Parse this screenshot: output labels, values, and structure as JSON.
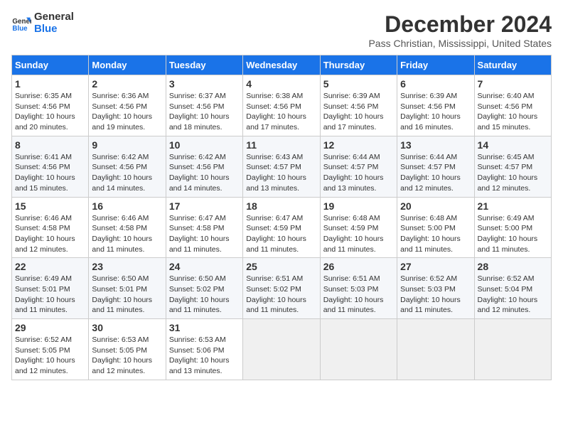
{
  "logo": {
    "line1": "General",
    "line2": "Blue"
  },
  "title": "December 2024",
  "location": "Pass Christian, Mississippi, United States",
  "days_of_week": [
    "Sunday",
    "Monday",
    "Tuesday",
    "Wednesday",
    "Thursday",
    "Friday",
    "Saturday"
  ],
  "weeks": [
    [
      {
        "day": "1",
        "sunrise": "6:35 AM",
        "sunset": "4:56 PM",
        "daylight": "10 hours and 20 minutes."
      },
      {
        "day": "2",
        "sunrise": "6:36 AM",
        "sunset": "4:56 PM",
        "daylight": "10 hours and 19 minutes."
      },
      {
        "day": "3",
        "sunrise": "6:37 AM",
        "sunset": "4:56 PM",
        "daylight": "10 hours and 18 minutes."
      },
      {
        "day": "4",
        "sunrise": "6:38 AM",
        "sunset": "4:56 PM",
        "daylight": "10 hours and 17 minutes."
      },
      {
        "day": "5",
        "sunrise": "6:39 AM",
        "sunset": "4:56 PM",
        "daylight": "10 hours and 17 minutes."
      },
      {
        "day": "6",
        "sunrise": "6:39 AM",
        "sunset": "4:56 PM",
        "daylight": "10 hours and 16 minutes."
      },
      {
        "day": "7",
        "sunrise": "6:40 AM",
        "sunset": "4:56 PM",
        "daylight": "10 hours and 15 minutes."
      }
    ],
    [
      {
        "day": "8",
        "sunrise": "6:41 AM",
        "sunset": "4:56 PM",
        "daylight": "10 hours and 15 minutes."
      },
      {
        "day": "9",
        "sunrise": "6:42 AM",
        "sunset": "4:56 PM",
        "daylight": "10 hours and 14 minutes."
      },
      {
        "day": "10",
        "sunrise": "6:42 AM",
        "sunset": "4:56 PM",
        "daylight": "10 hours and 14 minutes."
      },
      {
        "day": "11",
        "sunrise": "6:43 AM",
        "sunset": "4:57 PM",
        "daylight": "10 hours and 13 minutes."
      },
      {
        "day": "12",
        "sunrise": "6:44 AM",
        "sunset": "4:57 PM",
        "daylight": "10 hours and 13 minutes."
      },
      {
        "day": "13",
        "sunrise": "6:44 AM",
        "sunset": "4:57 PM",
        "daylight": "10 hours and 12 minutes."
      },
      {
        "day": "14",
        "sunrise": "6:45 AM",
        "sunset": "4:57 PM",
        "daylight": "10 hours and 12 minutes."
      }
    ],
    [
      {
        "day": "15",
        "sunrise": "6:46 AM",
        "sunset": "4:58 PM",
        "daylight": "10 hours and 12 minutes."
      },
      {
        "day": "16",
        "sunrise": "6:46 AM",
        "sunset": "4:58 PM",
        "daylight": "10 hours and 11 minutes."
      },
      {
        "day": "17",
        "sunrise": "6:47 AM",
        "sunset": "4:58 PM",
        "daylight": "10 hours and 11 minutes."
      },
      {
        "day": "18",
        "sunrise": "6:47 AM",
        "sunset": "4:59 PM",
        "daylight": "10 hours and 11 minutes."
      },
      {
        "day": "19",
        "sunrise": "6:48 AM",
        "sunset": "4:59 PM",
        "daylight": "10 hours and 11 minutes."
      },
      {
        "day": "20",
        "sunrise": "6:48 AM",
        "sunset": "5:00 PM",
        "daylight": "10 hours and 11 minutes."
      },
      {
        "day": "21",
        "sunrise": "6:49 AM",
        "sunset": "5:00 PM",
        "daylight": "10 hours and 11 minutes."
      }
    ],
    [
      {
        "day": "22",
        "sunrise": "6:49 AM",
        "sunset": "5:01 PM",
        "daylight": "10 hours and 11 minutes."
      },
      {
        "day": "23",
        "sunrise": "6:50 AM",
        "sunset": "5:01 PM",
        "daylight": "10 hours and 11 minutes."
      },
      {
        "day": "24",
        "sunrise": "6:50 AM",
        "sunset": "5:02 PM",
        "daylight": "10 hours and 11 minutes."
      },
      {
        "day": "25",
        "sunrise": "6:51 AM",
        "sunset": "5:02 PM",
        "daylight": "10 hours and 11 minutes."
      },
      {
        "day": "26",
        "sunrise": "6:51 AM",
        "sunset": "5:03 PM",
        "daylight": "10 hours and 11 minutes."
      },
      {
        "day": "27",
        "sunrise": "6:52 AM",
        "sunset": "5:03 PM",
        "daylight": "10 hours and 11 minutes."
      },
      {
        "day": "28",
        "sunrise": "6:52 AM",
        "sunset": "5:04 PM",
        "daylight": "10 hours and 12 minutes."
      }
    ],
    [
      {
        "day": "29",
        "sunrise": "6:52 AM",
        "sunset": "5:05 PM",
        "daylight": "10 hours and 12 minutes."
      },
      {
        "day": "30",
        "sunrise": "6:53 AM",
        "sunset": "5:05 PM",
        "daylight": "10 hours and 12 minutes."
      },
      {
        "day": "31",
        "sunrise": "6:53 AM",
        "sunset": "5:06 PM",
        "daylight": "10 hours and 13 minutes."
      },
      null,
      null,
      null,
      null
    ]
  ],
  "labels": {
    "sunrise": "Sunrise:",
    "sunset": "Sunset:",
    "daylight": "Daylight:"
  }
}
